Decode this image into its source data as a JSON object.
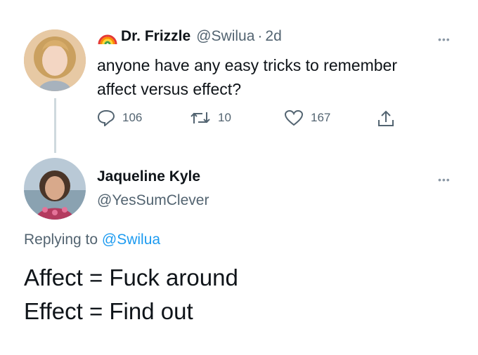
{
  "tweet": {
    "author_name": "Dr. Frizzle",
    "handle": "@Swilua",
    "separator": "·",
    "time": "2d",
    "text_line1": "anyone have any easy tricks to remember",
    "text_line2": "affect versus effect?",
    "actions": {
      "replies": "106",
      "retweets": "10",
      "likes": "167"
    },
    "avatar_icon": "person-avatar-icon",
    "badge_icon": "rainbow-icon"
  },
  "reply": {
    "author_name": "Jaqueline Kyle",
    "handle": "@YesSumClever",
    "replying_prefix": "Replying to",
    "replying_handle": "@Swilua",
    "line1": "Affect = Fuck around",
    "line2": "Effect = Find out",
    "avatar_icon": "person-avatar-icon"
  },
  "colors": {
    "link": "#1d9bf0",
    "muted": "#536471",
    "text": "#0f1419",
    "line": "#cfd9de"
  }
}
